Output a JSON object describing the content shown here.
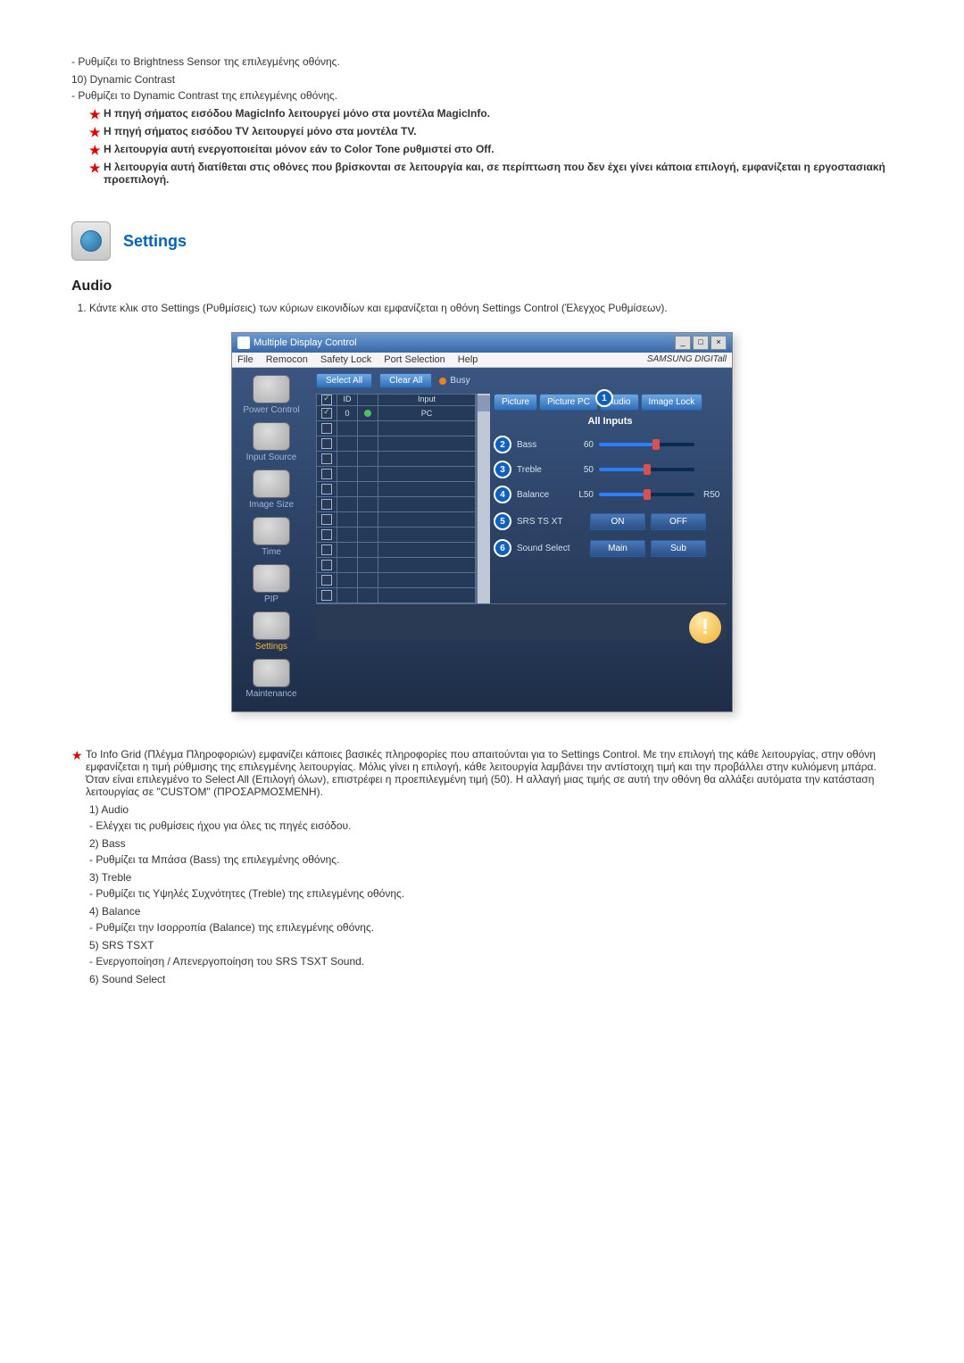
{
  "top_list": {
    "item10_sub": "- Ρυθμίζει το Brightness Sensor της επιλεγμένης οθόνης.",
    "item10_num": "10) Dynamic Contrast",
    "item10_sub2": "- Ρυθμίζει το Dynamic Contrast της επιλεγμένης οθόνης."
  },
  "star_notes": [
    "Η πηγή σήματος εισόδου MagicInfo λειτουργεί μόνο στα μοντέλα MagicInfo.",
    "Η πηγή σήματος εισόδου TV λειτουργεί μόνο στα μοντέλα TV.",
    "Η λειτουργία αυτή ενεργοποιείται μόνον εάν το Color Tone ρυθμιστεί στο Off.",
    "Η λειτουργία αυτή διατίθεται στις οθόνες που βρίσκονται σε λειτουργία και, σε περίπτωση που δεν έχει γίνει κάποια επιλογή, εμφανίζεται η εργοστασιακή προεπιλογή."
  ],
  "section": {
    "title": "Settings"
  },
  "audio": {
    "heading": "Audio",
    "step1": "Κάντε κλικ στο Settings (Ρυθμίσεις) των κύριων εικονιδίων και εμφανίζεται η οθόνη Settings Control (Έλεγχος Ρυθμίσεων)."
  },
  "app": {
    "title": "Multiple Display Control",
    "menu": [
      "File",
      "Remocon",
      "Safety Lock",
      "Port Selection",
      "Help"
    ],
    "brand": "SAMSUNG DIGITall",
    "select_all": "Select All",
    "clear_all": "Clear All",
    "busy": "Busy",
    "grid_headers": {
      "id": "ID",
      "input": "Input"
    },
    "grid_row1": {
      "id": "0",
      "input": "PC"
    },
    "sidebar": [
      {
        "label": "Power Control"
      },
      {
        "label": "Input Source"
      },
      {
        "label": "Image Size"
      },
      {
        "label": "Time"
      },
      {
        "label": "PIP"
      },
      {
        "label": "Settings"
      },
      {
        "label": "Maintenance"
      }
    ],
    "tabs": [
      "Picture",
      "Picture PC",
      "Audio",
      "Image Lock"
    ],
    "panel_title": "All Inputs",
    "sliders": [
      {
        "marker": "2",
        "label": "Bass",
        "value": "60",
        "pct": 60
      },
      {
        "marker": "3",
        "label": "Treble",
        "value": "50",
        "pct": 50
      },
      {
        "marker": "4",
        "label": "Balance",
        "value": "L50",
        "pct": 50,
        "right": "R50"
      }
    ],
    "options": [
      {
        "marker": "5",
        "label": "SRS TS XT",
        "a": "ON",
        "b": "OFF"
      },
      {
        "marker": "6",
        "label": "Sound Select",
        "a": "Main",
        "b": "Sub"
      }
    ]
  },
  "post_star": "Το Info Grid (Πλέγμα Πληροφοριών) εμφανίζει κάποιες βασικές πληροφορίες που απαιτούνται για το Settings Control. Με την επιλογή της κάθε λειτουργίας, στην οθόνη εμφανίζεται η τιμή ρύθμισης της επιλεγμένης λειτουργίας. Μόλις γίνει η επιλογή, κάθε λειτουργία λαμβάνει την αντίστοιχη τιμή και την προβάλλει στην κυλιόμενη μπάρα. Όταν είναι επιλεγμένο το Select All (Επιλογή όλων), επιστρέφει η προεπιλεγμένη τιμή (50). Η αλλαγή μιας τιμής σε αυτή την οθόνη θα αλλάξει αυτόματα την κατάσταση λειτουργίας σε \"CUSTOM\" (ΠΡΟΣΑΡΜΟΣΜΕΝΗ).",
  "items": [
    {
      "num": "1) Audio",
      "sub": "- Ελέγχει τις ρυθμίσεις ήχου για όλες τις πηγές εισόδου."
    },
    {
      "num": "2) Bass",
      "sub": "- Ρυθμίζει τα Μπάσα (Bass) της επιλεγμένης οθόνης."
    },
    {
      "num": "3) Treble",
      "sub": "- Ρυθμίζει τις Υψηλές Συχνότητες (Treble) της επιλεγμένης οθόνης."
    },
    {
      "num": "4) Balance",
      "sub": "- Ρυθμίζει την Ισορροπία (Balance) της επιλεγμένης οθόνης."
    },
    {
      "num": "5) SRS TSXT",
      "sub": "- Ενεργοποίηση / Απενεργοποίηση του SRS TSXT Sound."
    },
    {
      "num": "6) Sound Select",
      "sub": ""
    }
  ]
}
